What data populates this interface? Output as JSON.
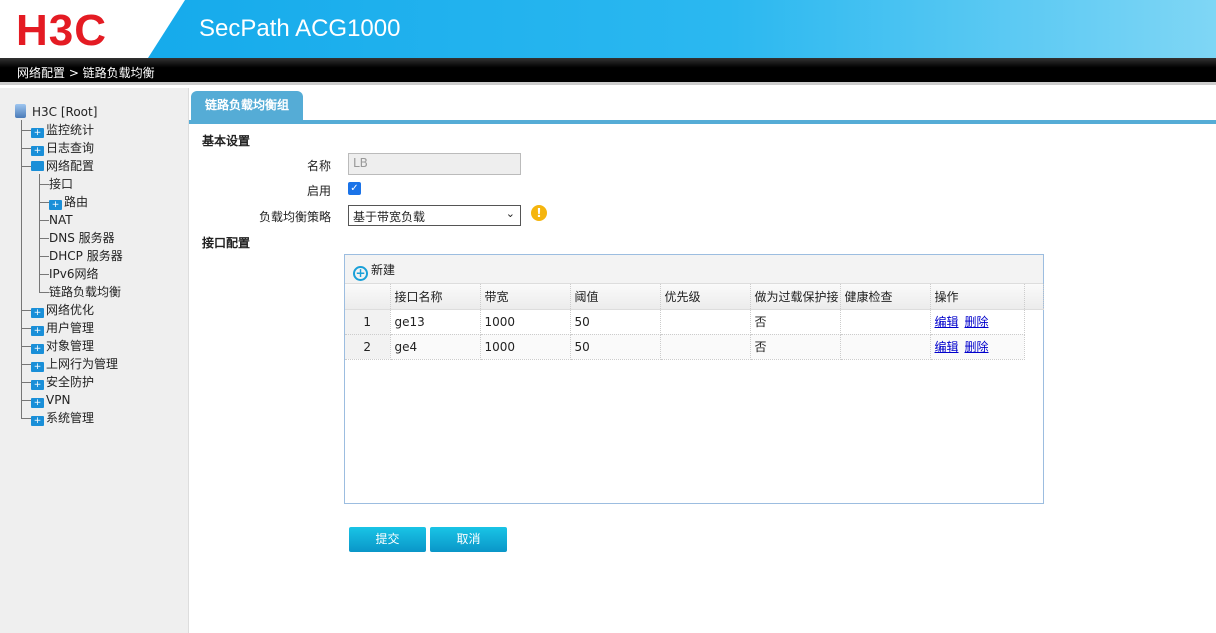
{
  "header": {
    "logo": "H3C",
    "title": "SecPath ACG1000"
  },
  "breadcrumb": "网络配置 > 链路负载均衡",
  "sidebar": {
    "root": "H3C [Root]",
    "items": [
      {
        "label": "监控统计",
        "level": 1,
        "folder": true
      },
      {
        "label": "日志查询",
        "level": 1,
        "folder": true
      },
      {
        "label": "网络配置",
        "level": 1,
        "folder": true,
        "open": true
      },
      {
        "label": "接口",
        "level": 2,
        "folder": false
      },
      {
        "label": "路由",
        "level": 2,
        "folder": true
      },
      {
        "label": "NAT",
        "level": 2,
        "folder": false
      },
      {
        "label": "DNS 服务器",
        "level": 2,
        "folder": false
      },
      {
        "label": "DHCP 服务器",
        "level": 2,
        "folder": false
      },
      {
        "label": "IPv6网络",
        "level": 2,
        "folder": false
      },
      {
        "label": "链路负载均衡",
        "level": 2,
        "folder": false
      },
      {
        "label": "网络优化",
        "level": 1,
        "folder": true
      },
      {
        "label": "用户管理",
        "level": 1,
        "folder": true
      },
      {
        "label": "对象管理",
        "level": 1,
        "folder": true
      },
      {
        "label": "上网行为管理",
        "level": 1,
        "folder": true
      },
      {
        "label": "安全防护",
        "level": 1,
        "folder": true
      },
      {
        "label": "VPN",
        "level": 1,
        "folder": true
      },
      {
        "label": "系统管理",
        "level": 1,
        "folder": true
      }
    ]
  },
  "tab": "链路负载均衡组",
  "basic": {
    "section": "基本设置",
    "name_label": "名称",
    "name_value": "LB",
    "enable_label": "启用",
    "enable_checked": true,
    "policy_label": "负载均衡策略",
    "policy_value": "基于带宽负载"
  },
  "iface": {
    "section": "接口配置",
    "new_label": "新建",
    "columns": [
      "",
      "接口名称",
      "带宽",
      "阈值",
      "优先级",
      "做为过载保护接",
      "健康检查",
      "操作"
    ],
    "rows": [
      {
        "no": "1",
        "name": "ge13",
        "bw": "1000",
        "th": "50",
        "pri": "",
        "ovl": "否",
        "hc": "",
        "edit": "编辑",
        "del": "删除"
      },
      {
        "no": "2",
        "name": "ge4",
        "bw": "1000",
        "th": "50",
        "pri": "",
        "ovl": "否",
        "hc": "",
        "edit": "编辑",
        "del": "删除"
      }
    ]
  },
  "buttons": {
    "submit": "提交",
    "cancel": "取消"
  },
  "colors": {
    "accent": "#55acd6",
    "brand_red": "#e41b23",
    "header_blue": "#10a7ea"
  }
}
